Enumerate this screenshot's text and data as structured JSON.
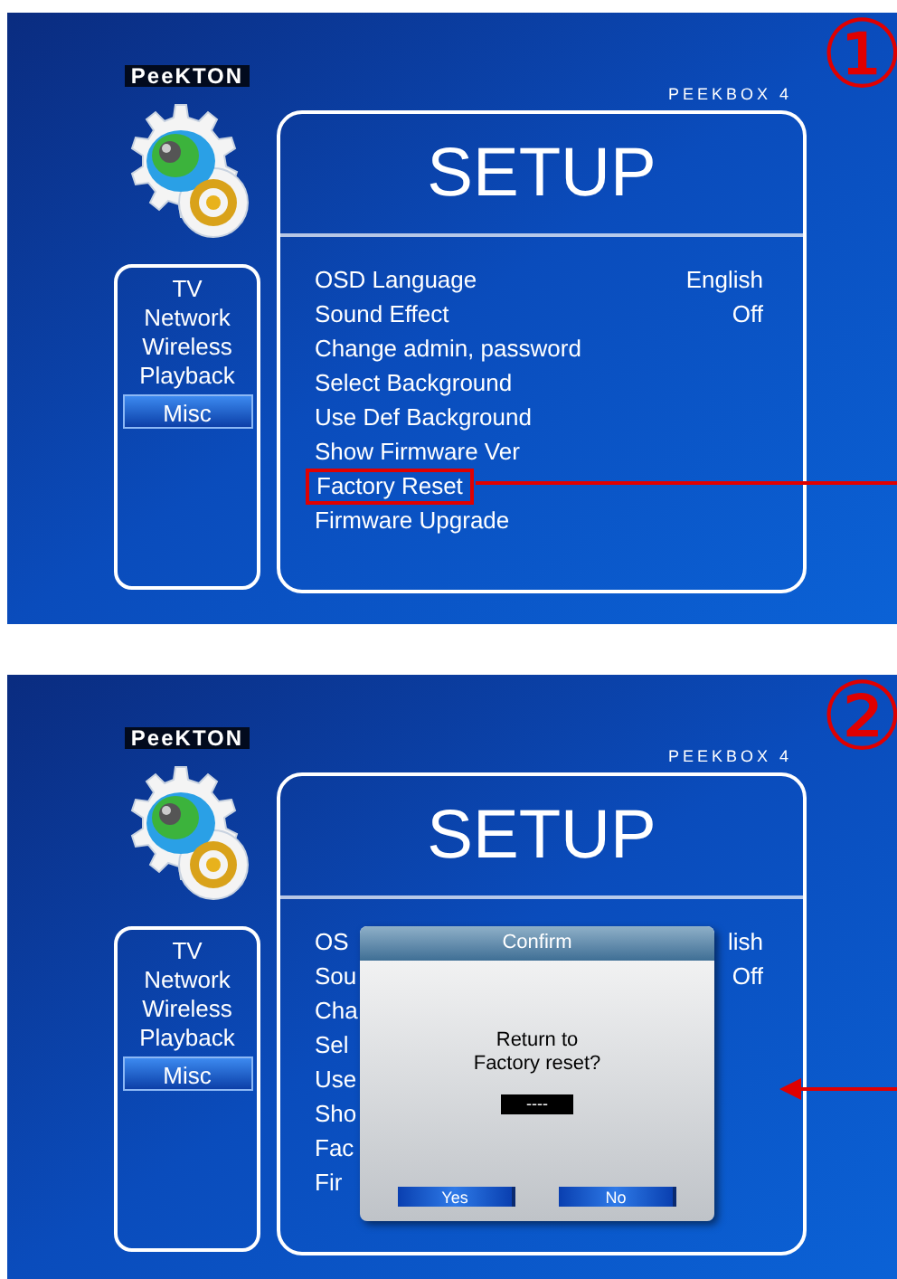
{
  "screens": [
    {
      "step_marker": "①",
      "logo": "PeeKTON",
      "model": "PEEKBOX 4",
      "title": "SETUP",
      "categories": [
        {
          "label": "TV",
          "selected": false
        },
        {
          "label": "Network",
          "selected": false
        },
        {
          "label": "Wireless",
          "selected": false
        },
        {
          "label": "Playback",
          "selected": false
        },
        {
          "label": "Misc",
          "selected": true
        }
      ],
      "settings": [
        {
          "label": "OSD Language",
          "value": "English",
          "highlighted": false
        },
        {
          "label": "Sound Effect",
          "value": "Off",
          "highlighted": false
        },
        {
          "label": "Change admin, password",
          "highlighted": false
        },
        {
          "label": "Select Background",
          "highlighted": false
        },
        {
          "label": "Use Def Background",
          "highlighted": false
        },
        {
          "label": "Show Firmware Ver",
          "highlighted": false
        },
        {
          "label": "Factory Reset",
          "highlighted": true
        },
        {
          "label": "Firmware Upgrade",
          "highlighted": false
        }
      ],
      "pointer": {
        "kind": "line"
      }
    },
    {
      "step_marker": "②",
      "logo": "PeeKTON",
      "model": "PEEKBOX 4",
      "title": "SETUP",
      "categories": [
        {
          "label": "TV",
          "selected": false
        },
        {
          "label": "Network",
          "selected": false
        },
        {
          "label": "Wireless",
          "selected": false
        },
        {
          "label": "Playback",
          "selected": false
        },
        {
          "label": "Misc",
          "selected": true
        }
      ],
      "settings": [
        {
          "label": "OS",
          "value": "lish"
        },
        {
          "label": "Sou",
          "value": "Off"
        },
        {
          "label": "Cha"
        },
        {
          "label": "Sel"
        },
        {
          "label": "Use"
        },
        {
          "label": "Sho"
        },
        {
          "label": "Fac"
        },
        {
          "label": "Fir"
        }
      ],
      "dialog": {
        "title": "Confirm",
        "message_lines": [
          "Return to",
          "Factory reset?"
        ],
        "code": "----",
        "buttons": [
          {
            "label": "Yes"
          },
          {
            "label": "No"
          }
        ]
      },
      "pointer": {
        "kind": "arrow"
      }
    }
  ]
}
